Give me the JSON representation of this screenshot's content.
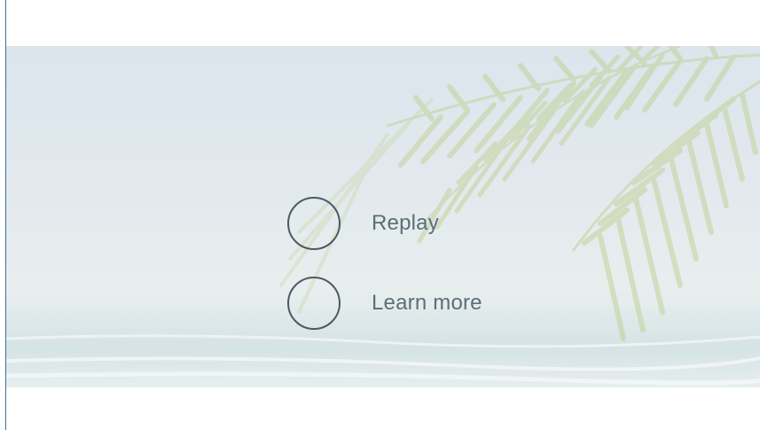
{
  "options": {
    "replay_label": "Replay",
    "learn_more_label": "Learn more"
  },
  "background": {
    "scene": "beach-with-palm-fronds",
    "sky_color": "#dbe5ec",
    "sea_color": "#dfe9ea",
    "frond_color": "#c9d6a8"
  },
  "colors": {
    "ring": "#4a5a62",
    "label": "#5c6e78",
    "left_rule": "#3f6f9a"
  }
}
